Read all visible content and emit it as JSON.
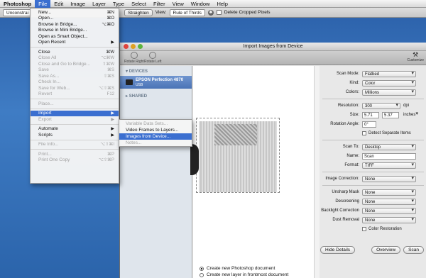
{
  "menubar": {
    "items": [
      "Photoshop",
      "File",
      "Edit",
      "Image",
      "Layer",
      "Type",
      "Select",
      "Filter",
      "View",
      "Window",
      "Help"
    ]
  },
  "options_bar": {
    "constrain": "Unconstrai",
    "straighten": "Straighten",
    "view_label": "View:",
    "view_value": "Rule of Thirds",
    "delete_cropped": "Delete Cropped Pixels"
  },
  "file_menu": {
    "items": [
      {
        "label": "New...",
        "shortcut": "⌘N",
        "disabled": false
      },
      {
        "label": "Open...",
        "shortcut": "⌘O",
        "disabled": false
      },
      {
        "label": "Browse in Bridge...",
        "shortcut": "⌥⌘O",
        "disabled": false
      },
      {
        "label": "Browse in Mini Bridge...",
        "shortcut": "",
        "disabled": false
      },
      {
        "label": "Open as Smart Object...",
        "shortcut": "",
        "disabled": false
      },
      {
        "label": "Open Recent",
        "shortcut": "▶",
        "disabled": false
      },
      {
        "label": "Close",
        "shortcut": "⌘W",
        "disabled": false
      },
      {
        "label": "Close All",
        "shortcut": "⌥⌘W",
        "disabled": true
      },
      {
        "label": "Close and Go to Bridge...",
        "shortcut": "⇧⌘W",
        "disabled": true
      },
      {
        "label": "Save",
        "shortcut": "⌘S",
        "disabled": true
      },
      {
        "label": "Save As...",
        "shortcut": "⇧⌘S",
        "disabled": true
      },
      {
        "label": "Check In...",
        "shortcut": "",
        "disabled": true
      },
      {
        "label": "Save for Web...",
        "shortcut": "⌥⇧⌘S",
        "disabled": true
      },
      {
        "label": "Revert",
        "shortcut": "F12",
        "disabled": true
      },
      {
        "label": "Place...",
        "shortcut": "",
        "disabled": true
      },
      {
        "label": "Import",
        "shortcut": "▶",
        "disabled": false
      },
      {
        "label": "Export",
        "shortcut": "▶",
        "disabled": true
      },
      {
        "label": "Automate",
        "shortcut": "▶",
        "disabled": false
      },
      {
        "label": "Scripts",
        "shortcut": "▶",
        "disabled": false
      },
      {
        "label": "File Info...",
        "shortcut": "⌥⇧⌘I",
        "disabled": true
      },
      {
        "label": "Print...",
        "shortcut": "⌘P",
        "disabled": true
      },
      {
        "label": "Print One Copy",
        "shortcut": "⌥⇧⌘P",
        "disabled": true
      }
    ]
  },
  "import_submenu": {
    "items": [
      {
        "label": "Variable Data Sets...",
        "disabled": true
      },
      {
        "label": "Video Frames to Layers...",
        "disabled": false
      },
      {
        "label": "Images from Device...",
        "disabled": false
      },
      {
        "label": "Notes...",
        "disabled": true
      }
    ]
  },
  "window": {
    "title": "Import Images from Device",
    "toolbar": {
      "rotate_right": "Rotate Right",
      "rotate_left": "Rotate Left",
      "customize": "Customize"
    },
    "sidebar": {
      "devices_header": "DEVICES",
      "device_name": "EPSON Perfection 4870",
      "device_sub": "USB",
      "shared_header": "SHARED"
    },
    "settings": {
      "scan_mode_label": "Scan Mode:",
      "scan_mode": "Flatbed",
      "kind_label": "Kind:",
      "kind": "Color",
      "colors_label": "Colors:",
      "colors": "Millions",
      "resolution_label": "Resolution:",
      "resolution": "300",
      "resolution_unit": "dpi",
      "size_label": "Size:",
      "size_w": "5.71",
      "size_h": "5.37",
      "size_unit": "inches",
      "rotation_label": "Rotation Angle:",
      "rotation": "0°",
      "detect_separate": "Detect Separate Items",
      "scan_to_label": "Scan To:",
      "scan_to": "Desktop",
      "name_label": "Name:",
      "name": "Scan",
      "format_label": "Format:",
      "format": "TIFF",
      "image_correction_label": "Image Correction:",
      "image_correction": "None",
      "unsharp_label": "Unsharp Mask",
      "unsharp": "None",
      "descreening_label": "Descreening",
      "descreening": "None",
      "backlight_label": "Backlight Correction",
      "backlight": "None",
      "dust_label": "Dust Removal",
      "dust": "None",
      "color_restoration": "Color Restoration"
    },
    "buttons": {
      "hide_details": "Hide Details",
      "overview": "Overview",
      "scan": "Scan"
    },
    "below": {
      "opt1": "Create new Photoshop document",
      "opt2": "Create new layer in frontmost document"
    }
  }
}
